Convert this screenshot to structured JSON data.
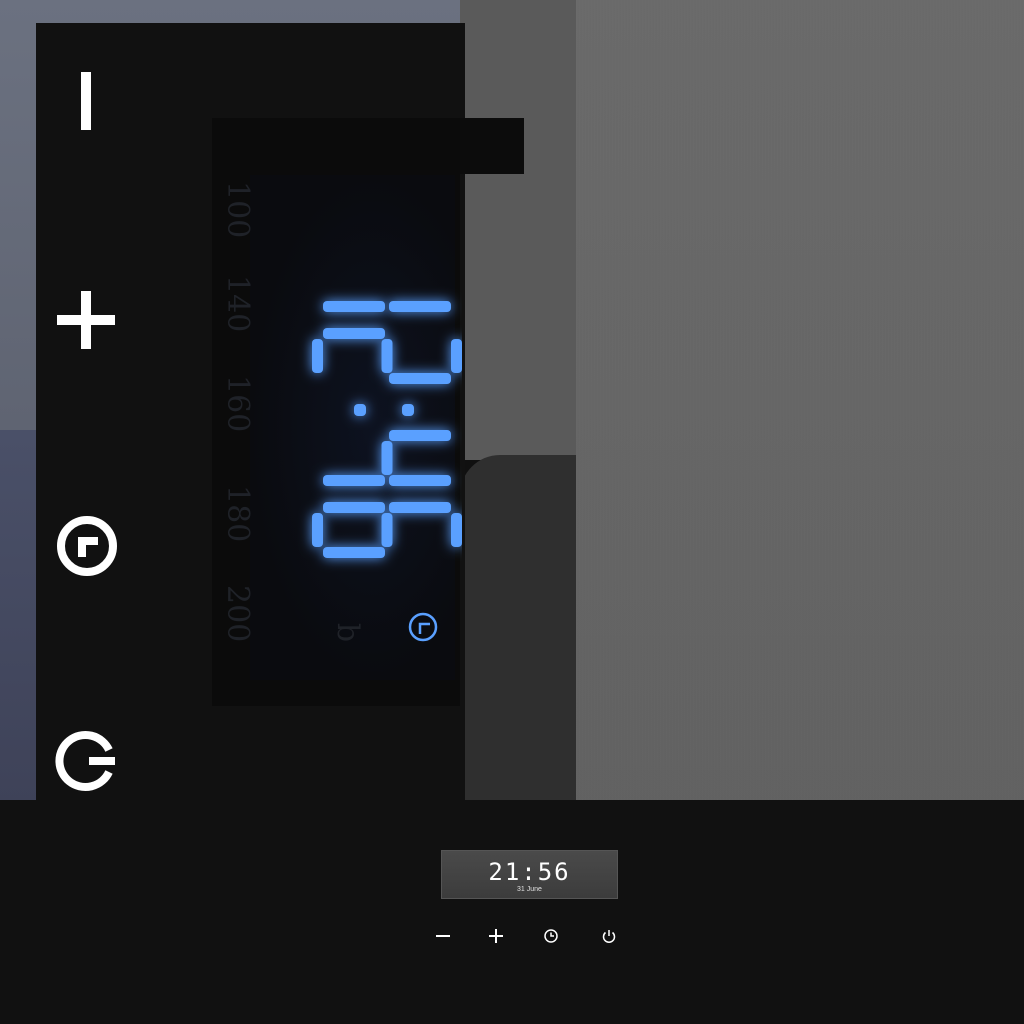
{
  "display": {
    "time_digits": "12:46",
    "scale_labels": [
      "100",
      "140",
      "160",
      "180",
      "200",
      "b"
    ],
    "led_color": "#5aa0ff"
  },
  "side_controls": [
    {
      "name": "minus-button",
      "icon": "minus-icon"
    },
    {
      "name": "plus-button",
      "icon": "plus-icon"
    },
    {
      "name": "timer-button",
      "icon": "clock-icon"
    },
    {
      "name": "power-button",
      "icon": "power-icon"
    }
  ],
  "mini_clock": {
    "time": "21:56",
    "date": "31 June"
  },
  "mini_controls": [
    {
      "name": "mini-minus-button",
      "icon": "minus-icon"
    },
    {
      "name": "mini-plus-button",
      "icon": "plus-icon"
    },
    {
      "name": "mini-clock-button",
      "icon": "clock-icon"
    },
    {
      "name": "mini-power-button",
      "icon": "power-icon"
    }
  ],
  "colors": {
    "accent": "#5aa0ff",
    "steel": "#666666",
    "panel": "#111111"
  }
}
